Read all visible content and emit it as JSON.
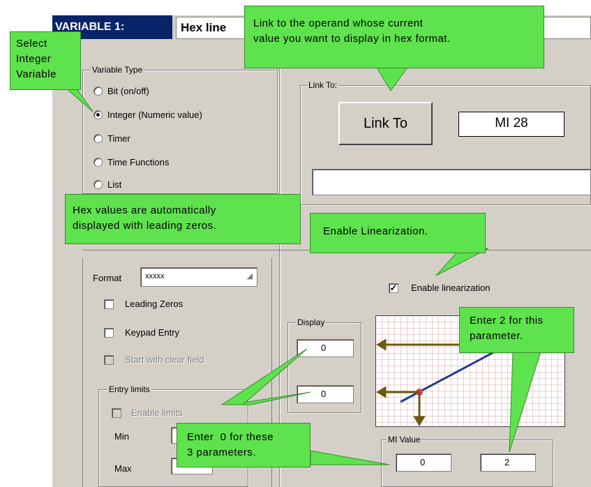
{
  "title": {
    "variable_label": "VARIABLE 1:",
    "name_value": "Hex line"
  },
  "variable_type": {
    "label": "Variable Type",
    "options": [
      "Bit (on/off)",
      "Integer (Numeric value)",
      "Timer",
      "Time Functions",
      "List"
    ],
    "selected": "Integer (Numeric value)"
  },
  "link": {
    "group_label": "Link To:",
    "button_label": "Link To",
    "operand_value": "MI 28",
    "description_value": ""
  },
  "format": {
    "label": "Format",
    "value": "xxxxx"
  },
  "checks": {
    "leading_zeros": "Leading Zeros",
    "keypad_entry": "Keypad Entry",
    "start_clear": "Start with clear field"
  },
  "entry_limits": {
    "label": "Entry limits",
    "enable": "Enable limits",
    "min_label": "Min",
    "max_label": "Max"
  },
  "linearization": {
    "label": "Enable linearization",
    "checked": true
  },
  "display": {
    "label": "Display",
    "value1": "0",
    "value2": "0"
  },
  "mi_value": {
    "label": "MI Value",
    "value1": "0",
    "value2": "2"
  },
  "callouts": {
    "select_integer": "Select\nInteger\nVariable",
    "link_operand": "Link to the operand whose current\nvalue you want to display in hex format.",
    "hex_values": "Hex values are automatically\ndisplayed with leading zeros.",
    "enable_linear": "Enable Linearization.",
    "enter_2": "Enter 2 for this\nparameter.",
    "enter_0": "Enter  0 for these\n3 parameters."
  },
  "colors": {
    "callout": "#5ee24d",
    "title_bg": "#0a246a",
    "graph_line": "#1f3d8a",
    "graph_arrow": "#6b5a10"
  }
}
